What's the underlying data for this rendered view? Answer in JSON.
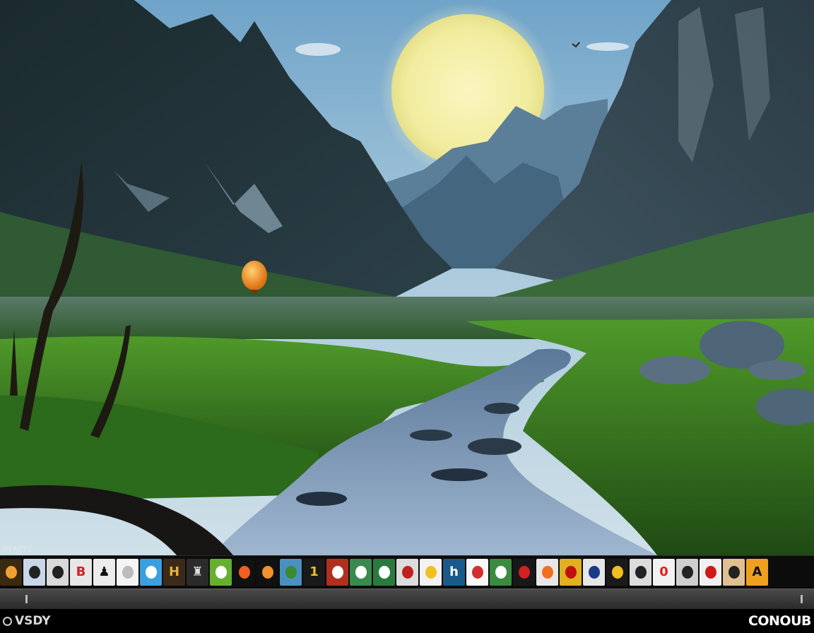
{
  "desktop": {
    "corner_text": "OVAITI"
  },
  "dock": {
    "tiles": [
      {
        "icon": "app-icon-orange-circle",
        "bg": "#3a2a10",
        "fg": "#f0a030",
        "glyph": ""
      },
      {
        "icon": "app-icon-person-portrait",
        "bg": "#c9d6e8",
        "fg": "#222",
        "glyph": ""
      },
      {
        "icon": "app-icon-person-portrait",
        "bg": "#d9d9d9",
        "fg": "#222",
        "glyph": ""
      },
      {
        "icon": "app-icon-red-b",
        "bg": "#e7e7e7",
        "fg": "#d42020",
        "glyph": "B"
      },
      {
        "icon": "app-icon-black-figure",
        "bg": "#ececec",
        "fg": "#111",
        "glyph": "♟"
      },
      {
        "icon": "app-icon-white-doc",
        "bg": "#f4f4f4",
        "fg": "#bbb",
        "glyph": ""
      },
      {
        "icon": "app-icon-sky-swirl",
        "bg": "#3aa0e0",
        "fg": "#fff",
        "glyph": ""
      },
      {
        "icon": "app-icon-brown-book",
        "bg": "#3b2a1a",
        "fg": "#e9b040",
        "glyph": "H"
      },
      {
        "icon": "app-icon-dark-figure",
        "bg": "#2b2b2b",
        "fg": "#ddd",
        "glyph": "♜"
      },
      {
        "icon": "app-icon-green-leaf",
        "bg": "#66b030",
        "fg": "#fff",
        "glyph": ""
      },
      {
        "icon": "app-icon-sunset-globe",
        "bg": "#111",
        "fg": "#f06020",
        "glyph": ""
      },
      {
        "icon": "app-icon-sun-globe",
        "bg": "#111",
        "fg": "#f09030",
        "glyph": ""
      },
      {
        "icon": "app-icon-landscape",
        "bg": "#4a90c0",
        "fg": "#3a8a30",
        "glyph": ""
      },
      {
        "icon": "app-icon-number-one",
        "bg": "#1a1a1a",
        "fg": "#f0c020",
        "glyph": "1"
      },
      {
        "icon": "app-icon-red-scene",
        "bg": "#b03020",
        "fg": "#fff",
        "glyph": ""
      },
      {
        "icon": "app-icon-green-field",
        "bg": "#3a8a50",
        "fg": "#fff",
        "glyph": ""
      },
      {
        "icon": "app-icon-green-hills",
        "bg": "#2a7a40",
        "fg": "#fff",
        "glyph": ""
      },
      {
        "icon": "app-icon-red-figure",
        "bg": "#dcdcdc",
        "fg": "#c02020",
        "glyph": ""
      },
      {
        "icon": "app-icon-yellow-shield",
        "bg": "#f2f2f2",
        "fg": "#f0c020",
        "glyph": ""
      },
      {
        "icon": "app-icon-teal-h",
        "bg": "#1a5a8a",
        "fg": "#fff",
        "glyph": "h"
      },
      {
        "icon": "app-icon-white-card",
        "bg": "#f7f7f7",
        "fg": "#d03030",
        "glyph": ""
      },
      {
        "icon": "app-icon-green-meadow",
        "bg": "#3a8a40",
        "fg": "#fff",
        "glyph": ""
      },
      {
        "icon": "app-icon-red-car",
        "bg": "#181818",
        "fg": "#d02020",
        "glyph": ""
      },
      {
        "icon": "app-icon-orange-ball",
        "bg": "#e8e8e8",
        "fg": "#f07020",
        "glyph": ""
      },
      {
        "icon": "app-icon-red-flower",
        "bg": "#e0b020",
        "fg": "#c01010",
        "glyph": ""
      },
      {
        "icon": "app-icon-eye",
        "bg": "#e6e6e6",
        "fg": "#1a3a8a",
        "glyph": ""
      },
      {
        "icon": "app-icon-yellow-drop",
        "bg": "#1a1a1a",
        "fg": "#f0c020",
        "glyph": ""
      },
      {
        "icon": "app-icon-camera",
        "bg": "#dcdcdc",
        "fg": "#222",
        "glyph": ""
      },
      {
        "icon": "app-icon-red-zero",
        "bg": "#f2f2f2",
        "fg": "#e02020",
        "glyph": "0"
      },
      {
        "icon": "app-icon-person-portrait",
        "bg": "#cfcfcf",
        "fg": "#222",
        "glyph": ""
      },
      {
        "icon": "app-icon-red-gift",
        "bg": "#f0f0f0",
        "fg": "#d01818",
        "glyph": ""
      },
      {
        "icon": "app-icon-person-portrait",
        "bg": "#e0c090",
        "fg": "#222",
        "glyph": ""
      },
      {
        "icon": "app-icon-orange-letter",
        "bg": "#f0a020",
        "fg": "#111",
        "glyph": "A"
      }
    ]
  },
  "brand": {
    "left": "VSDY",
    "right": "CONOUB"
  }
}
